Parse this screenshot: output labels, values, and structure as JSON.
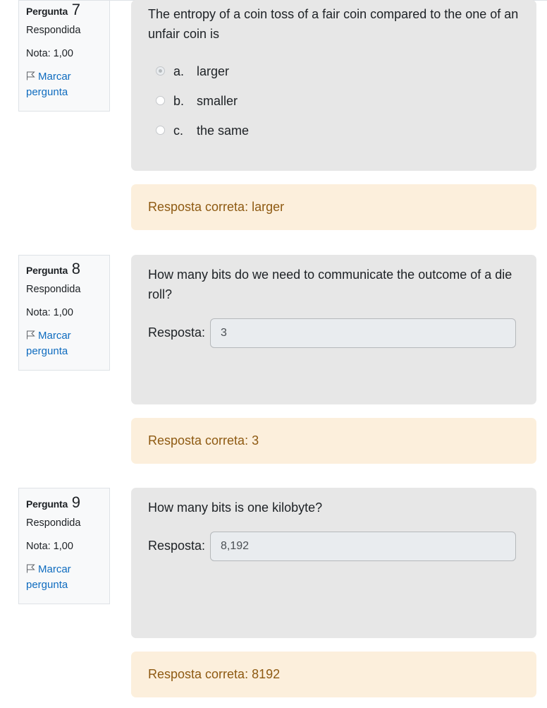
{
  "questions": [
    {
      "header_label": "Pergunta",
      "number": "7",
      "state": "Respondida",
      "grade": "Nota: 1,00",
      "flag_label": "Marcar pergunta",
      "text": "The entropy of a coin toss of a fair coin compared to the one of an unfair coin is",
      "options": [
        {
          "letter": "a.",
          "text": "larger",
          "selected": true
        },
        {
          "letter": "b.",
          "text": "smaller",
          "selected": false
        },
        {
          "letter": "c.",
          "text": "the same",
          "selected": false
        }
      ],
      "feedback": "Resposta correta: larger"
    },
    {
      "header_label": "Pergunta",
      "number": "8",
      "state": "Respondida",
      "grade": "Nota: 1,00",
      "flag_label": "Marcar pergunta",
      "text": "How many bits do we need to communicate the outcome of a die roll?",
      "answer_label": "Resposta:",
      "answer_value": "3",
      "feedback": "Resposta correta: 3"
    },
    {
      "header_label": "Pergunta",
      "number": "9",
      "state": "Respondida",
      "grade": "Nota: 1,00",
      "flag_label": "Marcar pergunta",
      "text": "How many bits is one kilobyte?",
      "answer_label": "Resposta:",
      "answer_value": "8,192",
      "feedback": "Resposta correta: 8192"
    }
  ],
  "colors": {
    "info_bg": "#f8f9fa",
    "question_bg": "#e7e7e7",
    "feedback_bg": "#fcefdc",
    "feedback_text": "#8e5a12",
    "link": "#0f6cbf"
  },
  "icons": {
    "flag": "flag-icon"
  }
}
